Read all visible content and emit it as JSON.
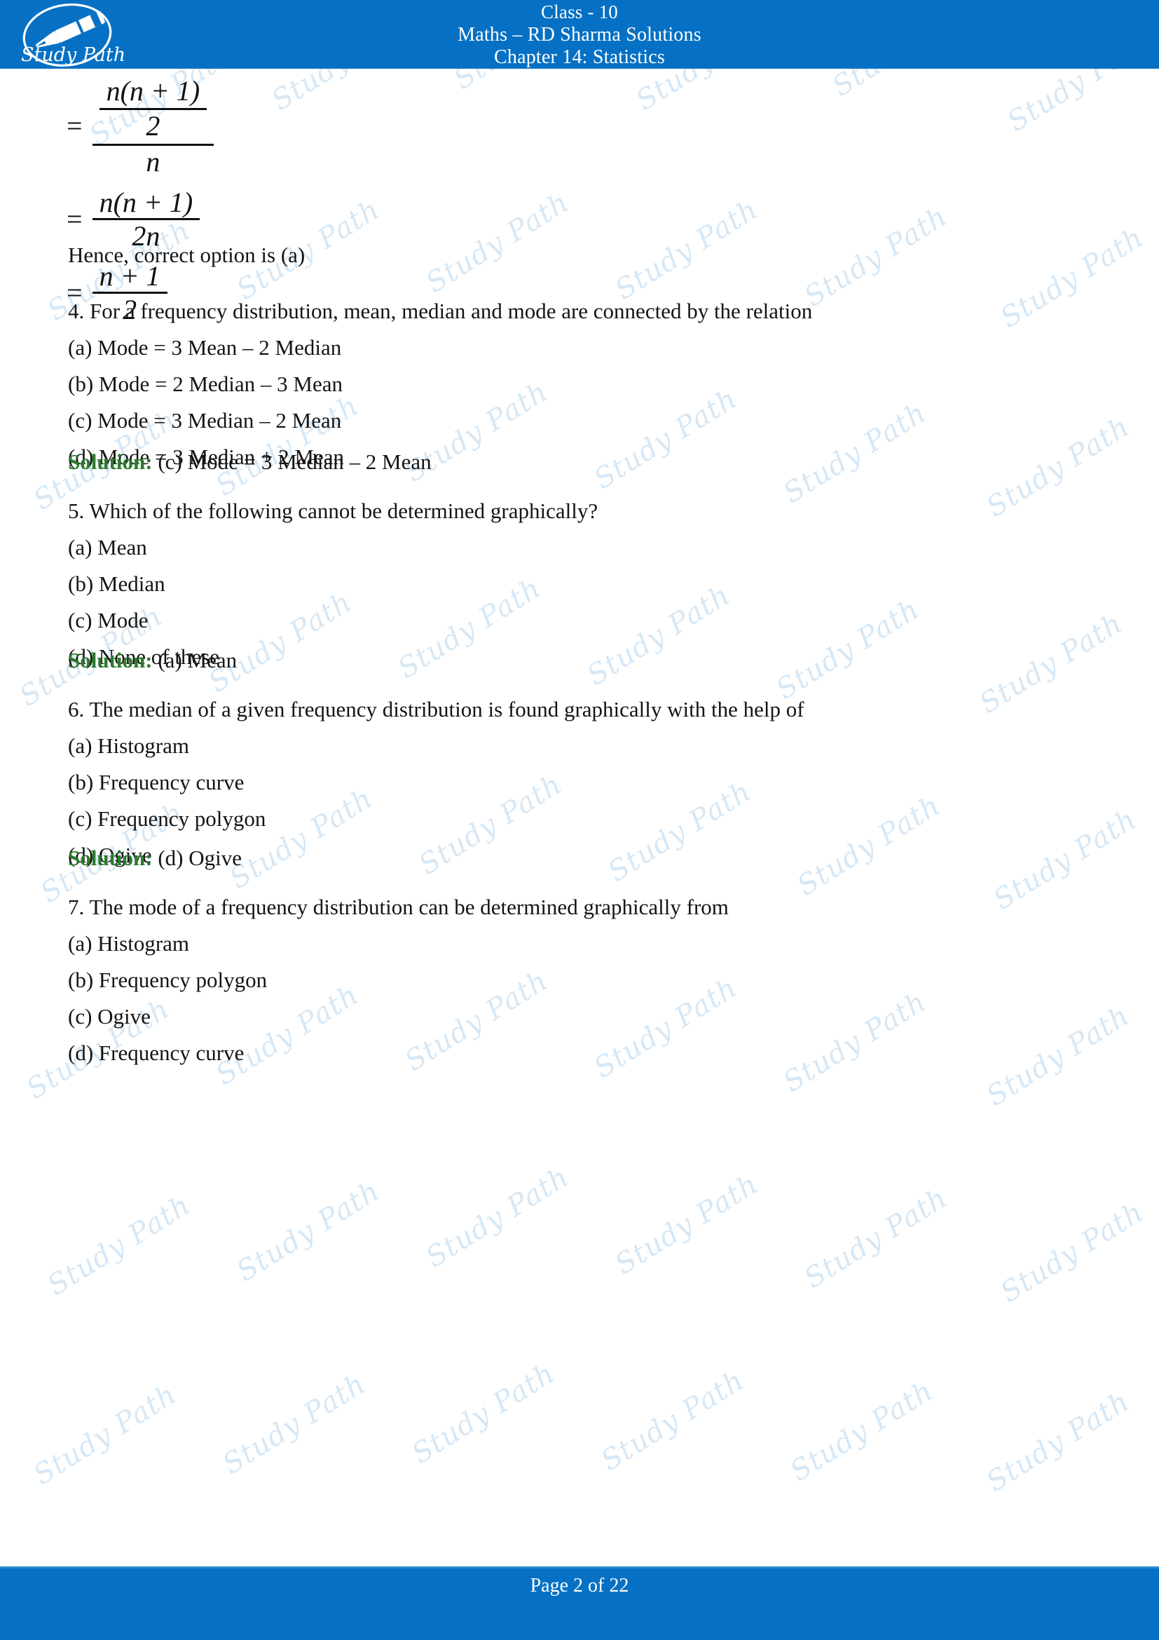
{
  "header": {
    "line1": "Class - 10",
    "line2": "Maths – RD Sharma Solutions",
    "line3": "Chapter 14: Statistics",
    "logo_text": "Study Path",
    "background_color": "#0671C4"
  },
  "watermark": {
    "text": "Study Path",
    "color": "#CFE4F5"
  },
  "math": {
    "step1": {
      "equals": "=",
      "num_outer_num": "n(n + 1)",
      "num_outer_den": "2",
      "den": "n"
    },
    "step2": {
      "equals": "=",
      "num": "n(n + 1)",
      "den": "2n"
    },
    "step3": {
      "equals": "=",
      "num": "n + 1",
      "den": "2"
    }
  },
  "conclusion": "Hence, correct option is (a)",
  "questions": [
    {
      "number": "4.",
      "text": "For a frequency distribution, mean, median and mode are connected by the relation",
      "options": [
        "(a) Mode = 3 Mean – 2 Median",
        "(b) Mode = 2 Median – 3 Mean",
        "(c) Mode = 3 Median – 2 Mean",
        "(d) Mode = 3 Median + 2 Mean"
      ],
      "solution_label": "Solution:",
      "solution_text": "(c) Mode = 3 Median – 2 Mean"
    },
    {
      "number": "5.",
      "text": "Which of the following cannot be determined graphically?",
      "options": [
        "(a) Mean",
        "(b) Median",
        "(c) Mode",
        "(d) None of these"
      ],
      "solution_label": "Solution:",
      "solution_text": "(a) Mean"
    },
    {
      "number": "6.",
      "text": "The median of a given frequency distribution is found graphically with the help of",
      "options": [
        "(a) Histogram",
        "(b) Frequency curve",
        "(c) Frequency polygon",
        "(d) Ogive"
      ],
      "solution_label": "Solution:",
      "solution_text": "(d) Ogive"
    },
    {
      "number": "7.",
      "text": "The mode of a frequency distribution can be determined graphically from",
      "options": [
        "(a) Histogram",
        "(b) Frequency polygon",
        "(c) Ogive",
        "(d) Frequency curve"
      ],
      "solution_label": "",
      "solution_text": ""
    }
  ],
  "footer": {
    "page_text": "Page 2 of 22",
    "background_color": "#0671C4"
  }
}
